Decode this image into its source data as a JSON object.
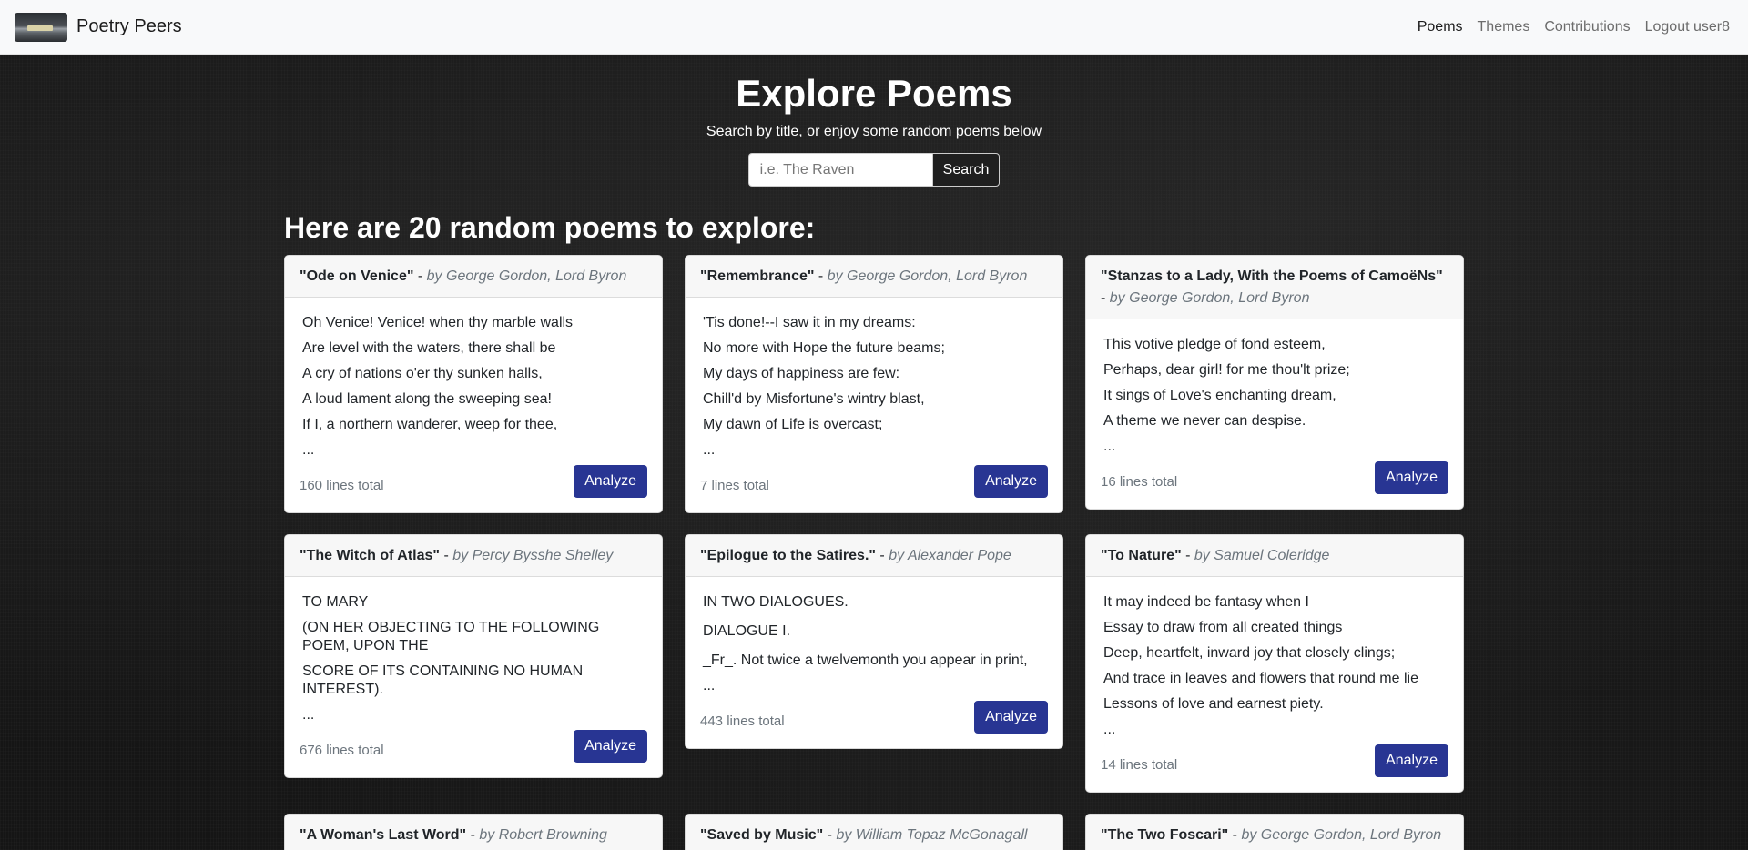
{
  "nav": {
    "brand": "Poetry Peers",
    "links": [
      {
        "label": "Poems",
        "active": true
      },
      {
        "label": "Themes",
        "active": false
      },
      {
        "label": "Contributions",
        "active": false
      },
      {
        "label": "Logout user8",
        "active": false
      }
    ]
  },
  "hero": {
    "title": "Explore Poems",
    "subtitle": "Search by title, or enjoy some random poems below",
    "search_placeholder": "i.e. The Raven",
    "search_button": "Search"
  },
  "section_title": "Here are 20 random poems to explore:",
  "analyze_label": "Analyze",
  "cards": [
    {
      "title": "\"Ode on Venice\"",
      "author": "by George Gordon, Lord Byron",
      "lines": [
        "Oh Venice! Venice! when thy marble walls",
        "Are level with the waters, there shall be",
        "A cry of nations o'er thy sunken halls,",
        "A loud lament along the sweeping sea!",
        "If I, a northern wanderer, weep for thee,",
        "..."
      ],
      "total": "160 lines total"
    },
    {
      "title": "\"Remembrance\"",
      "author": "by George Gordon, Lord Byron",
      "lines": [
        "'Tis done!--I saw it in my dreams:",
        "No more with Hope the future beams;",
        "My days of happiness are few:",
        "Chill'd by Misfortune's wintry blast,",
        "My dawn of Life is overcast;",
        "..."
      ],
      "total": "7 lines total"
    },
    {
      "title": "\"Stanzas to a Lady, With the Poems of CamoëNs\"",
      "author": "by George Gordon, Lord Byron",
      "lines": [
        "This votive pledge of fond esteem,",
        "Perhaps, dear girl! for me thou'lt prize;",
        "It sings of Love's enchanting dream,",
        "A theme we never can despise.",
        "..."
      ],
      "total": "16 lines total"
    },
    {
      "title": "\"The Witch of Atlas\"",
      "author": "by Percy Bysshe Shelley",
      "lines": [
        "TO MARY",
        "(ON HER OBJECTING TO THE FOLLOWING POEM, UPON THE",
        "SCORE OF ITS CONTAINING NO HUMAN INTEREST).",
        "..."
      ],
      "total": "676 lines total"
    },
    {
      "title": "\"Epilogue to the Satires.\"",
      "author": "by Alexander Pope",
      "lines": [
        "IN TWO DIALOGUES.",
        "DIALOGUE I.",
        "_Fr_. Not twice a twelvemonth you appear in print,",
        "..."
      ],
      "total": "443 lines total"
    },
    {
      "title": "\"To Nature\"",
      "author": "by Samuel Coleridge",
      "lines": [
        "It may indeed be fantasy when I",
        "Essay to draw from all created things",
        "Deep, heartfelt, inward joy that closely clings;",
        "And trace in leaves and flowers that round me lie",
        "Lessons of love and earnest piety.",
        "..."
      ],
      "total": "14 lines total"
    },
    {
      "title": "\"A Woman's Last Word\"",
      "author": "by Robert Browning",
      "lines": [],
      "total": ""
    },
    {
      "title": "\"Saved by Music\"",
      "author": "by William Topaz McGonagall",
      "lines": [],
      "total": ""
    },
    {
      "title": "\"The Two Foscari\"",
      "author": "by George Gordon, Lord Byron",
      "lines": [],
      "total": ""
    }
  ]
}
